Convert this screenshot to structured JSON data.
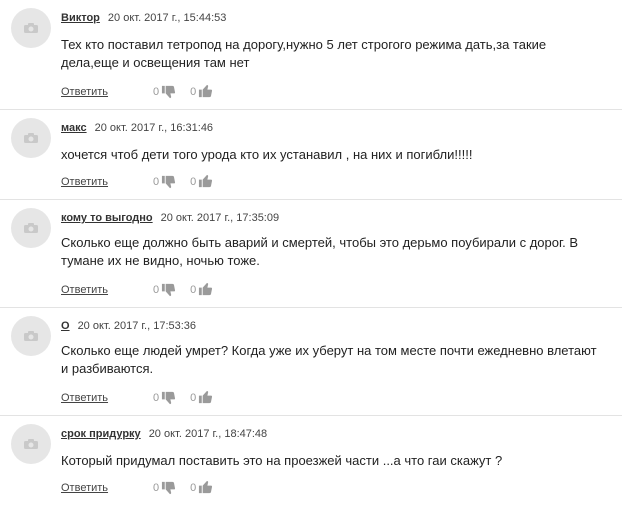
{
  "comments": [
    {
      "author": "Виктор",
      "date": "20 окт. 2017 г., 15:44:53",
      "text": "Тех кто поставил тетропод на дорогу,нужно 5 лет строгого режима дать,за такие дела,еще и освещения там нет",
      "reply_label": "Ответить",
      "dislikes": "0",
      "likes": "0"
    },
    {
      "author": "макс",
      "date": "20 окт. 2017 г., 16:31:46",
      "text": "хочется чтоб дети того урода кто их устанавил , на них и погибли!!!!!",
      "reply_label": "Ответить",
      "dislikes": "0",
      "likes": "0"
    },
    {
      "author": "кому то выгодно",
      "date": "20 окт. 2017 г., 17:35:09",
      "text": "Сколько еще должно быть аварий и смертей, чтобы это дерьмо поубирали с дорог. В тумане их не видно, ночью тоже.",
      "reply_label": "Ответить",
      "dislikes": "0",
      "likes": "0"
    },
    {
      "author": "О",
      "date": "20 окт. 2017 г., 17:53:36",
      "text": "Сколько еще людей умрет? Когда уже их уберут на том месте почти ежедневно влетают и разбиваются.",
      "reply_label": "Ответить",
      "dislikes": "0",
      "likes": "0"
    },
    {
      "author": "срок придурку",
      "date": "20 окт. 2017 г., 18:47:48",
      "text": "Который придумал поставить это на проезжей части ...а что гаи скажут ?",
      "reply_label": "Ответить",
      "dislikes": "0",
      "likes": "0"
    }
  ]
}
